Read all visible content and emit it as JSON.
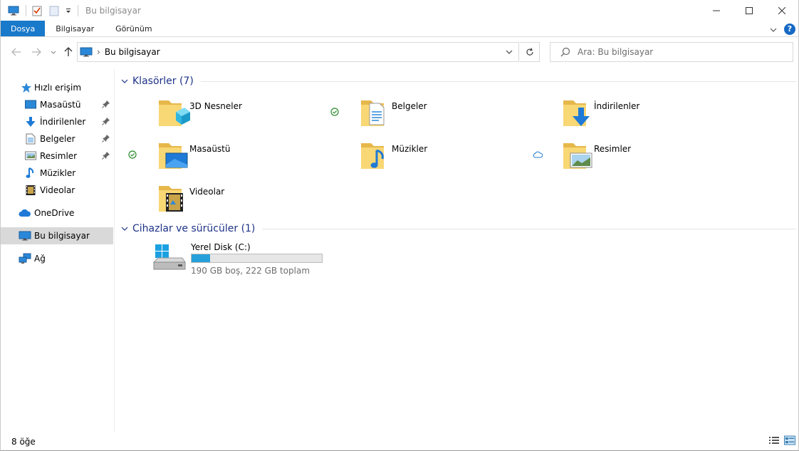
{
  "window": {
    "title": "Bu bilgisayar"
  },
  "ribbon": {
    "tabs": [
      "Dosya",
      "Bilgisayar",
      "Görünüm"
    ],
    "help": "?"
  },
  "address": {
    "path": "Bu bilgisayar",
    "separator": "›"
  },
  "search": {
    "placeholder": "Ara: Bu bilgisayar"
  },
  "sidebar": {
    "quick_access": "Hızlı erişim",
    "pinned": [
      {
        "label": "Masaüstü",
        "icon": "desktop-icon"
      },
      {
        "label": "İndirilenler",
        "icon": "downloads-icon"
      },
      {
        "label": "Belgeler",
        "icon": "documents-icon"
      },
      {
        "label": "Resimler",
        "icon": "pictures-icon"
      }
    ],
    "unpinned": [
      {
        "label": "Müzikler",
        "icon": "music-icon"
      },
      {
        "label": "Videolar",
        "icon": "videos-icon"
      }
    ],
    "onedrive": "OneDrive",
    "this_pc": "Bu bilgisayar",
    "network": "Ağ"
  },
  "folders": {
    "header": "Klasörler (7)",
    "items": [
      {
        "label": "3D Nesneler",
        "icon": "3d-objects-folder-icon",
        "status": ""
      },
      {
        "label": "Belgeler",
        "icon": "documents-folder-icon",
        "status": "synced"
      },
      {
        "label": "İndirilenler",
        "icon": "downloads-folder-icon",
        "status": ""
      },
      {
        "label": "Masaüstü",
        "icon": "desktop-folder-icon",
        "status": "synced"
      },
      {
        "label": "Müzikler",
        "icon": "music-folder-icon",
        "status": ""
      },
      {
        "label": "Resimler",
        "icon": "pictures-folder-icon",
        "status": "cloud"
      },
      {
        "label": "Videolar",
        "icon": "videos-folder-icon",
        "status": ""
      }
    ]
  },
  "devices": {
    "header": "Cihazlar ve sürücüler (1)",
    "drive": {
      "name": "Yerel Disk (C:)",
      "info": "190 GB boş, 222 GB toplam",
      "used_fraction": 0.144
    }
  },
  "statusbar": {
    "count": "8 öğe"
  },
  "colors": {
    "accent": "#1979ca",
    "group_header": "#1e3287",
    "drive_fill": "#26a0da",
    "folder": "#f8d775"
  }
}
